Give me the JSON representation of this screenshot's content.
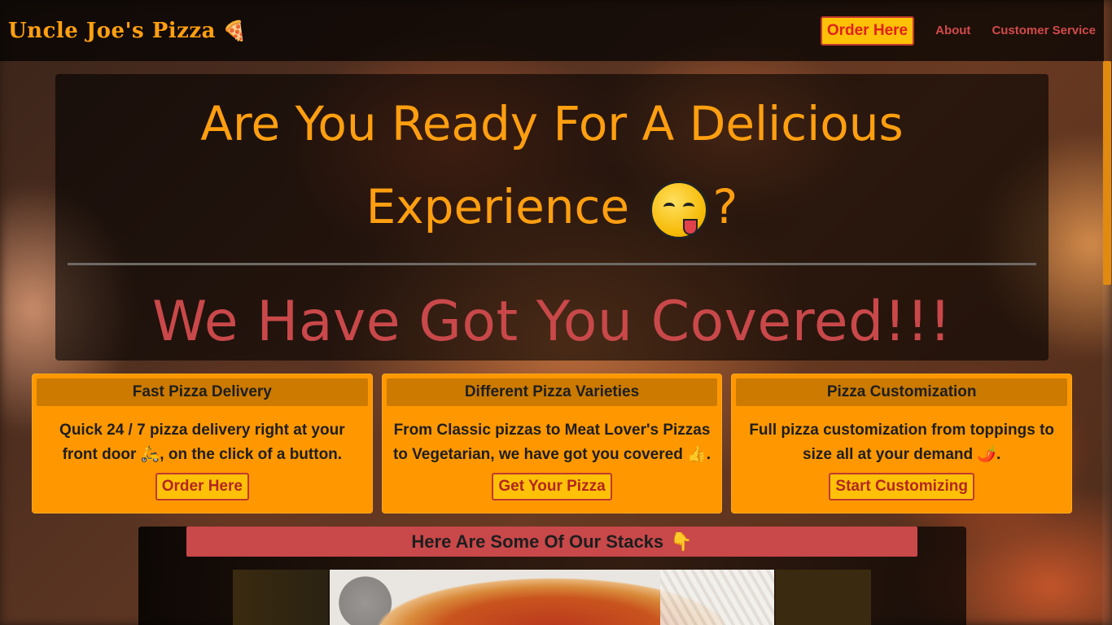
{
  "navbar": {
    "brand": "Uncle Joe's Pizza",
    "brand_icon": "pizza-slice-icon",
    "order_button": "Order Here",
    "links": [
      "About",
      "Customer Service"
    ]
  },
  "hero": {
    "title_line1": "Are You Ready For A Delicious",
    "title_line2": "Experience",
    "title_suffix": "?",
    "emoji": "face-savoring-food-icon",
    "subtitle": "We Have Got You Covered!!!"
  },
  "cards": [
    {
      "header": "Fast Pizza Delivery",
      "body": "Quick 24 / 7 pizza delivery right at your front door 🛵, on the click of a button.",
      "button": "Order Here"
    },
    {
      "header": "Different Pizza Varieties",
      "body": "From Classic pizzas to Meat Lover's Pizzas to Vegetarian, we have got you covered 👍.",
      "button": "Get Your Pizza"
    },
    {
      "header": "Pizza Customization",
      "body": "Full pizza customization from toppings to size all at your demand 🌶️.",
      "button": "Start Customizing"
    }
  ],
  "stacks": {
    "title": "Here Are Some Of Our Stacks",
    "title_icon": "👇"
  },
  "colors": {
    "accent": "#ff9f10",
    "card_bg": "#ff9800",
    "card_header": "#cc7a00",
    "button_bg": "#ffc107",
    "red": "#c9484a"
  }
}
